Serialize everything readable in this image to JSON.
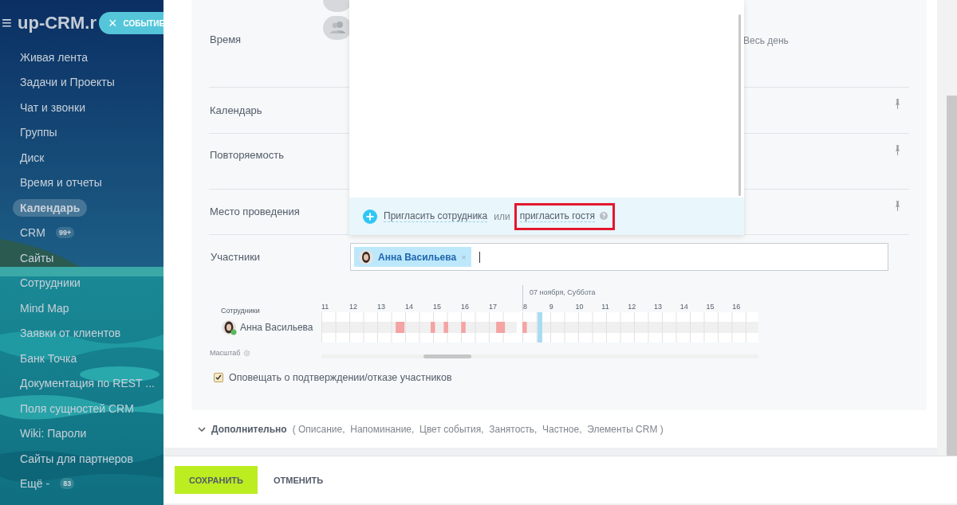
{
  "sidebar": {
    "logo": "up-CRM.r",
    "menu_icon": "≡",
    "new_button": {
      "icon": "×",
      "label": "СОБЫТИЕ"
    },
    "items": [
      {
        "label": "Живая лента",
        "selected": false
      },
      {
        "label": "Задачи и Проекты",
        "selected": false
      },
      {
        "label": "Чат и звонки",
        "selected": false
      },
      {
        "label": "Группы",
        "selected": false
      },
      {
        "label": "Диск",
        "selected": false
      },
      {
        "label": "Время и отчеты",
        "selected": false
      },
      {
        "label": "Календарь",
        "selected": true
      },
      {
        "label": "CRM",
        "badge": "99+",
        "selected": false
      },
      {
        "label": "Сайты",
        "selected": false
      },
      {
        "label": "Сотрудники",
        "selected": false
      },
      {
        "label": "Mind Map",
        "selected": false
      },
      {
        "label": "Заявки от клиентов",
        "selected": false
      },
      {
        "label": "Банк Точка",
        "selected": false
      },
      {
        "label": "Документация по REST ...",
        "selected": false
      },
      {
        "label": "Поля сущностей CRM",
        "selected": false
      },
      {
        "label": "Wiki: Пароли",
        "selected": false
      },
      {
        "label": "Сайты для партнеров",
        "selected": false
      },
      {
        "label": "Ещё -",
        "badge": "83",
        "selected": false
      }
    ]
  },
  "form": {
    "rows": [
      {
        "label": "Время",
        "pin": false
      },
      {
        "label": "Календарь",
        "pin": true
      },
      {
        "label": "Повторяемость",
        "pin": true
      },
      {
        "label": "Место проведения",
        "pin": true
      }
    ],
    "all_day_label": "Весь день",
    "invite_popup": {
      "invite_employee": "Пригласить сотрудника",
      "or": "или",
      "invite_guest": "пригласить гостя",
      "highlighted": true
    },
    "participants": {
      "label": "Участники",
      "chips": [
        {
          "name": "Анна Васильева",
          "remove": "×"
        }
      ]
    },
    "schedule": {
      "column_label": "Сотрудники",
      "date_label": "07 ноября, Суббота",
      "hours_day1": [
        "11",
        "12",
        "13",
        "14",
        "15",
        "16",
        "17"
      ],
      "hours_day2": [
        "8",
        "9",
        "10",
        "11",
        "12",
        "13",
        "14",
        "15",
        "16"
      ],
      "people": [
        {
          "name": "Анна Васильева"
        }
      ],
      "scale_label": "Масштаб"
    },
    "notify": {
      "label": "Оповещать о подтверждении/отказе участников",
      "checked": true
    }
  },
  "extra": {
    "label": "Дополнительно",
    "details": "( Описание,  Напоминание,  Цвет события,  Занятость,  Частное,  Элементы CRM )"
  },
  "footer": {
    "save": "СОХРАНИТЬ",
    "cancel": "ОТМЕНИТЬ"
  }
}
